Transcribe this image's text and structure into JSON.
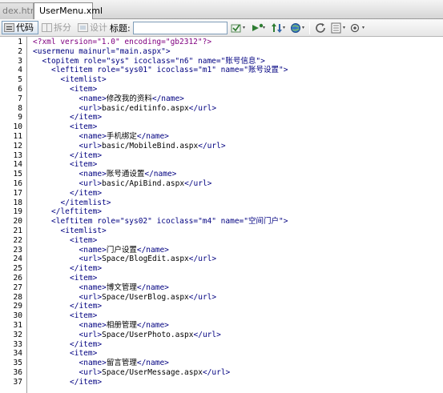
{
  "tabs": [
    {
      "label": "dex.html",
      "active": false
    },
    {
      "label": "UserMenu.xml",
      "active": true
    }
  ],
  "toolbar": {
    "code_label": "代码",
    "split_label": "拆分",
    "design_label": "设计",
    "title_label": "标题:",
    "title_value": "",
    "icons": [
      "check-browser-icon",
      "live-view-icon",
      "file-transfer-icon",
      "preview-globe-icon",
      "refresh-icon",
      "view-options-icon",
      "visual-aids-icon"
    ]
  },
  "editor": {
    "lines": [
      {
        "n": "1",
        "indent": 0,
        "parts": [
          [
            "decl",
            "<?xml version=\"1.0\" encoding=\"gb2312\"?>"
          ]
        ]
      },
      {
        "n": "2",
        "indent": 0,
        "parts": [
          [
            "tag",
            "<usermenu "
          ],
          [
            "attr",
            "mainurl="
          ],
          [
            "str",
            "\"main.aspx\""
          ],
          [
            "tag",
            ">"
          ]
        ]
      },
      {
        "n": "3",
        "indent": 1,
        "parts": [
          [
            "tag",
            "<topitem "
          ],
          [
            "attr",
            "role="
          ],
          [
            "str",
            "\"sys\" "
          ],
          [
            "attr",
            "icoclass="
          ],
          [
            "str",
            "\"n6\" "
          ],
          [
            "attr",
            "name="
          ],
          [
            "str",
            "\"账号信息\""
          ],
          [
            "tag",
            ">"
          ]
        ]
      },
      {
        "n": "4",
        "indent": 2,
        "parts": [
          [
            "tag",
            "<leftitem "
          ],
          [
            "attr",
            "role="
          ],
          [
            "str",
            "\"sys01\" "
          ],
          [
            "attr",
            "icoclass="
          ],
          [
            "str",
            "\"m1\" "
          ],
          [
            "attr",
            "name="
          ],
          [
            "str",
            "\"账号设置\""
          ],
          [
            "tag",
            ">"
          ]
        ]
      },
      {
        "n": "5",
        "indent": 3,
        "parts": [
          [
            "tag",
            "<itemlist>"
          ]
        ]
      },
      {
        "n": "6",
        "indent": 4,
        "parts": [
          [
            "tag",
            "<item>"
          ]
        ]
      },
      {
        "n": "7",
        "indent": 5,
        "parts": [
          [
            "tag",
            "<name>"
          ],
          [
            "txt",
            "修改我的资料"
          ],
          [
            "tag",
            "</name>"
          ]
        ]
      },
      {
        "n": "8",
        "indent": 5,
        "parts": [
          [
            "tag",
            "<url>"
          ],
          [
            "txt",
            "basic/editinfo.aspx"
          ],
          [
            "tag",
            "</url>"
          ]
        ]
      },
      {
        "n": "9",
        "indent": 4,
        "parts": [
          [
            "tag",
            "</item>"
          ]
        ]
      },
      {
        "n": "10",
        "indent": 4,
        "parts": [
          [
            "tag",
            "<item>"
          ]
        ]
      },
      {
        "n": "11",
        "indent": 5,
        "parts": [
          [
            "tag",
            "<name>"
          ],
          [
            "txt",
            "手机绑定"
          ],
          [
            "tag",
            "</name>"
          ]
        ]
      },
      {
        "n": "12",
        "indent": 5,
        "parts": [
          [
            "tag",
            "<url>"
          ],
          [
            "txt",
            "basic/MobileBind.aspx"
          ],
          [
            "tag",
            "</url>"
          ]
        ]
      },
      {
        "n": "13",
        "indent": 4,
        "parts": [
          [
            "tag",
            "</item>"
          ]
        ]
      },
      {
        "n": "14",
        "indent": 4,
        "parts": [
          [
            "tag",
            "<item>"
          ]
        ]
      },
      {
        "n": "15",
        "indent": 5,
        "parts": [
          [
            "tag",
            "<name>"
          ],
          [
            "txt",
            "账号通设置"
          ],
          [
            "tag",
            "</name>"
          ]
        ]
      },
      {
        "n": "16",
        "indent": 5,
        "parts": [
          [
            "tag",
            "<url>"
          ],
          [
            "txt",
            "basic/ApiBind.aspx"
          ],
          [
            "tag",
            "</url>"
          ]
        ]
      },
      {
        "n": "17",
        "indent": 4,
        "parts": [
          [
            "tag",
            "</item>"
          ]
        ]
      },
      {
        "n": "18",
        "indent": 3,
        "parts": [
          [
            "tag",
            "</itemlist>"
          ]
        ]
      },
      {
        "n": "19",
        "indent": 2,
        "parts": [
          [
            "tag",
            "</leftitem>"
          ]
        ]
      },
      {
        "n": "20",
        "indent": 2,
        "parts": [
          [
            "tag",
            "<leftitem "
          ],
          [
            "attr",
            "role="
          ],
          [
            "str",
            "\"sys02\" "
          ],
          [
            "attr",
            "icoclass="
          ],
          [
            "str",
            "\"m4\" "
          ],
          [
            "attr",
            "name="
          ],
          [
            "str",
            "\"空间门户\""
          ],
          [
            "tag",
            ">"
          ]
        ]
      },
      {
        "n": "21",
        "indent": 3,
        "parts": [
          [
            "tag",
            "<itemlist>"
          ]
        ]
      },
      {
        "n": "22",
        "indent": 4,
        "parts": [
          [
            "tag",
            "<item>"
          ]
        ]
      },
      {
        "n": "23",
        "indent": 5,
        "parts": [
          [
            "tag",
            "<name>"
          ],
          [
            "txt",
            "门户设置"
          ],
          [
            "tag",
            "</name>"
          ]
        ]
      },
      {
        "n": "24",
        "indent": 5,
        "parts": [
          [
            "tag",
            "<url>"
          ],
          [
            "txt",
            "Space/BlogEdit.aspx"
          ],
          [
            "tag",
            "</url>"
          ]
        ]
      },
      {
        "n": "25",
        "indent": 4,
        "parts": [
          [
            "tag",
            "</item>"
          ]
        ]
      },
      {
        "n": "26",
        "indent": 4,
        "parts": [
          [
            "tag",
            "<item>"
          ]
        ]
      },
      {
        "n": "27",
        "indent": 5,
        "parts": [
          [
            "tag",
            "<name>"
          ],
          [
            "txt",
            "博文管理"
          ],
          [
            "tag",
            "</name>"
          ]
        ]
      },
      {
        "n": "28",
        "indent": 5,
        "parts": [
          [
            "tag",
            "<url>"
          ],
          [
            "txt",
            "Space/UserBlog.aspx"
          ],
          [
            "tag",
            "</url>"
          ]
        ]
      },
      {
        "n": "29",
        "indent": 4,
        "parts": [
          [
            "tag",
            "</item>"
          ]
        ]
      },
      {
        "n": "30",
        "indent": 4,
        "parts": [
          [
            "tag",
            "<item>"
          ]
        ]
      },
      {
        "n": "31",
        "indent": 5,
        "parts": [
          [
            "tag",
            "<name>"
          ],
          [
            "txt",
            "相册管理"
          ],
          [
            "tag",
            "</name>"
          ]
        ]
      },
      {
        "n": "32",
        "indent": 5,
        "parts": [
          [
            "tag",
            "<url>"
          ],
          [
            "txt",
            "Space/UserPhoto.aspx"
          ],
          [
            "tag",
            "</url>"
          ]
        ]
      },
      {
        "n": "33",
        "indent": 4,
        "parts": [
          [
            "tag",
            "</item>"
          ]
        ]
      },
      {
        "n": "34",
        "indent": 4,
        "parts": [
          [
            "tag",
            "<item>"
          ]
        ]
      },
      {
        "n": "35",
        "indent": 5,
        "parts": [
          [
            "tag",
            "<name>"
          ],
          [
            "txt",
            "留言管理"
          ],
          [
            "tag",
            "</name>"
          ]
        ]
      },
      {
        "n": "36",
        "indent": 5,
        "parts": [
          [
            "tag",
            "<url>"
          ],
          [
            "txt",
            "Space/UserMessage.aspx"
          ],
          [
            "tag",
            "</url>"
          ]
        ]
      },
      {
        "n": "37",
        "indent": 4,
        "parts": [
          [
            "tag",
            "</item>"
          ]
        ]
      }
    ]
  }
}
